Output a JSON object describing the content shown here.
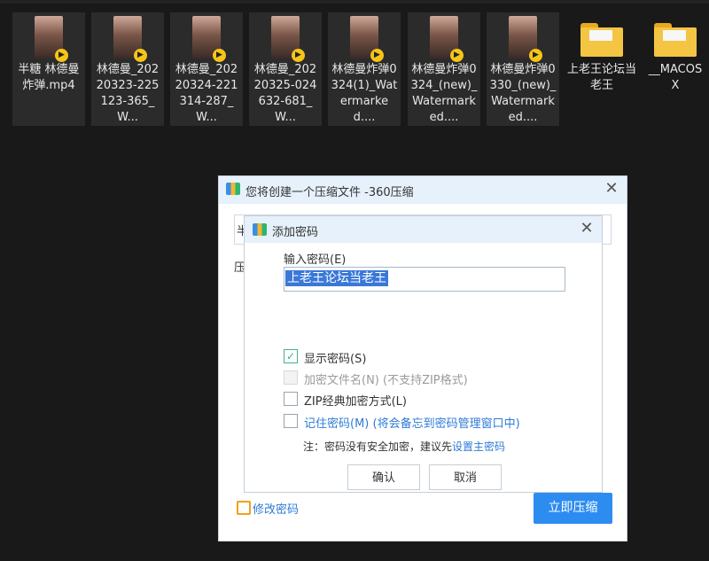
{
  "files": [
    {
      "name": "半糖 林德曼炸弹.mp4",
      "kind": "video",
      "icon": "video-thumbnail-icon"
    },
    {
      "name": "林德曼_20220323-225123-365_W...",
      "kind": "video",
      "icon": "video-thumbnail-icon"
    },
    {
      "name": "林德曼_20220324-221314-287_W...",
      "kind": "video",
      "icon": "video-thumbnail-icon"
    },
    {
      "name": "林德曼_20220325-024632-681_W...",
      "kind": "video",
      "icon": "video-thumbnail-icon"
    },
    {
      "name": "林德曼炸弹0324(1)_Watermarked....",
      "kind": "video",
      "icon": "video-thumbnail-icon"
    },
    {
      "name": "林德曼炸弹0324_(new)_Watermarked....",
      "kind": "video",
      "icon": "video-thumbnail-icon"
    },
    {
      "name": "林德曼炸弹0330_(new)_Watermarked....",
      "kind": "video",
      "icon": "video-thumbnail-icon"
    },
    {
      "name": "上老王论坛当老王",
      "kind": "folder",
      "icon": "folder-icon"
    },
    {
      "name": "__MACOSX",
      "kind": "folder",
      "icon": "folder-icon"
    }
  ],
  "compress_dialog": {
    "title": "您将创建一个压缩文件 -360压缩",
    "partial_input_text": "半",
    "partial_label": "压",
    "modify_password_link": "修改密码",
    "start_button": "立即压缩"
  },
  "password_dialog": {
    "title": "添加密码",
    "input_label": "输入密码(E)",
    "password_value": "上老王论坛当老王",
    "options": {
      "show_password": {
        "label": "显示密码(S)",
        "checked": true
      },
      "encrypt_filenames": {
        "label": "加密文件名(N) (不支持ZIP格式)",
        "checked": false,
        "disabled": true
      },
      "zip_classic": {
        "label": "ZIP经典加密方式(L)",
        "checked": false
      },
      "remember_password": {
        "label": "记住密码(M) (将会备忘到密码管理窗口中)",
        "checked": false
      }
    },
    "note_prefix": "注：密码没有安全加密，建议先",
    "note_link": "设置主密码",
    "confirm_button": "确认",
    "cancel_button": "取消"
  },
  "colors": {
    "background": "#191919",
    "accent_blue": "#2d8cf0",
    "check_green": "#3eb489",
    "link_blue": "#2d7ad6"
  }
}
